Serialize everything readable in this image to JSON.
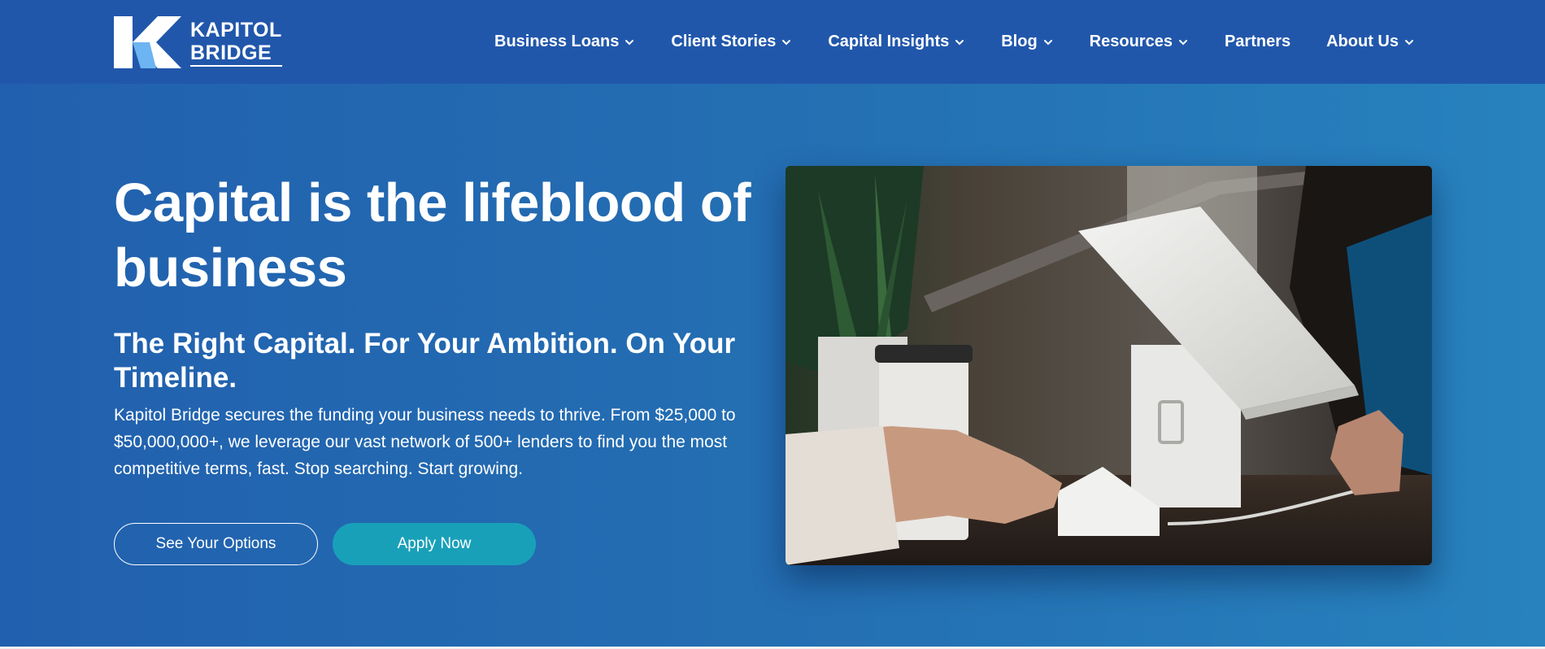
{
  "brand": {
    "name_line1": "KAPITOL",
    "name_line2": "BRIDGE",
    "logo_icon": "k-logo-icon"
  },
  "nav": {
    "items": [
      {
        "label": "Business Loans",
        "has_dropdown": true
      },
      {
        "label": "Client Stories",
        "has_dropdown": true
      },
      {
        "label": "Capital Insights",
        "has_dropdown": true
      },
      {
        "label": "Blog",
        "has_dropdown": true
      },
      {
        "label": "Resources",
        "has_dropdown": true
      },
      {
        "label": "Partners",
        "has_dropdown": false
      },
      {
        "label": "About Us",
        "has_dropdown": true
      }
    ]
  },
  "hero": {
    "title": "Capital is the lifeblood of business",
    "subtitle": "The Right Capital. For Your Ambition. On Your Timeline.",
    "description": "Kapitol Bridge secures the funding your business needs to thrive. From $25,000 to $50,000,000+, we leverage our vast network of 500+ lenders to find you the most competitive terms, fast. Stop searching. Start growing.",
    "cta_secondary": "See Your Options",
    "cta_primary": "Apply Now",
    "image_subject": "payment-terminal-photo"
  },
  "colors": {
    "header_bg": "#2157ab",
    "hero_gradient_start": "#2160ae",
    "hero_gradient_end": "#2782bd",
    "primary_button": "#19a0b9",
    "text": "#ffffff"
  }
}
